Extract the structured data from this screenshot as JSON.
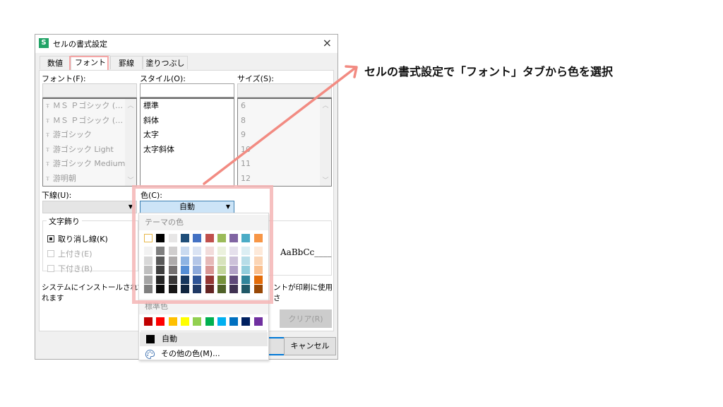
{
  "annotation": {
    "text": "セルの書式設定で「フォント」タブから色を選択",
    "arrow_color": "#f28b82",
    "highlight_color": "#f5b5b5"
  },
  "dialog": {
    "title": "セルの書式設定",
    "app_icon": "S",
    "close_icon": "×",
    "tabs": [
      {
        "label": "数値",
        "active": false
      },
      {
        "label": "フォント",
        "active": true
      },
      {
        "label": "罫線",
        "active": false
      },
      {
        "label": "塗りつぶし",
        "active": false
      }
    ],
    "font": {
      "label": "フォント(F):",
      "value": "",
      "items": [
        "ＭＳ Ｐゴシック (…",
        "ＭＳ Ｐゴシック (…",
        "游ゴシック",
        "游ゴシック Light",
        "游ゴシック Medium",
        "游明朝"
      ]
    },
    "style": {
      "label": "スタイル(O):",
      "value": "",
      "items": [
        "標準",
        "斜体",
        "太字",
        "太字斜体"
      ]
    },
    "size": {
      "label": "サイズ(S):",
      "value": "",
      "items": [
        "6",
        "8",
        "9",
        "10",
        "11",
        "12"
      ]
    },
    "underline": {
      "label": "下線(U):",
      "value": ""
    },
    "color": {
      "label": "色(C):",
      "value": "自動"
    },
    "effects": {
      "title": "文字飾り",
      "strikethrough": {
        "label": "取り消し線(K)",
        "state": "indeterminate"
      },
      "superscript": {
        "label": "上付き(E)",
        "state": "unchecked-disabled"
      },
      "subscript": {
        "label": "下付き(B)",
        "state": "unchecked-disabled"
      }
    },
    "preview": {
      "text": "AaBbCc____"
    },
    "description_left": "システムにインストールされてい",
    "description_right": "ントが印刷に使用さ",
    "description_line2": "れます",
    "clear_button": "クリア(R)",
    "cancel_button": "キャンセル"
  },
  "color_popup": {
    "theme_header": "テーマの色",
    "theme_top": [
      "#ffffff",
      "#000000",
      "#e7e6e6",
      "#1f4e79",
      "#4472c4",
      "#c0504d",
      "#9bbb59",
      "#8064a2",
      "#4bacc6",
      "#f79646"
    ],
    "theme_shades": [
      [
        "#f2f2f2",
        "#7f7f7f",
        "#d0cece",
        "#c9daf0",
        "#dae3f3",
        "#f2dcdb",
        "#ebf1dd",
        "#e5e0ec",
        "#dbeef3",
        "#fde9d9"
      ],
      [
        "#d8d8d8",
        "#595959",
        "#aeabab",
        "#8eb4e3",
        "#b4c6e7",
        "#e6b9b8",
        "#d7e3bc",
        "#ccc1d9",
        "#b7dde8",
        "#fbd5b5"
      ],
      [
        "#bfbfbf",
        "#3f3f3f",
        "#757171",
        "#558ed5",
        "#8eaadb",
        "#d99694",
        "#c3d69b",
        "#b2a2c7",
        "#92cddc",
        "#fac08f"
      ],
      [
        "#a5a5a5",
        "#262626",
        "#3a3838",
        "#17375e",
        "#2f5496",
        "#953734",
        "#76923c",
        "#5f497a",
        "#31859b",
        "#e36c09"
      ],
      [
        "#7f7f7f",
        "#0c0c0c",
        "#171616",
        "#10253f",
        "#1f3864",
        "#632423",
        "#4f6128",
        "#3f3151",
        "#205867",
        "#974806"
      ]
    ],
    "standard_header": "標準色",
    "standard": [
      "#c00000",
      "#ff0000",
      "#ffc000",
      "#ffff00",
      "#92d050",
      "#00b050",
      "#00b0f0",
      "#0070c0",
      "#002060",
      "#7030a0"
    ],
    "auto_label": "自動",
    "auto_color": "#000000",
    "more_colors_label": "その他の色(M)..."
  }
}
